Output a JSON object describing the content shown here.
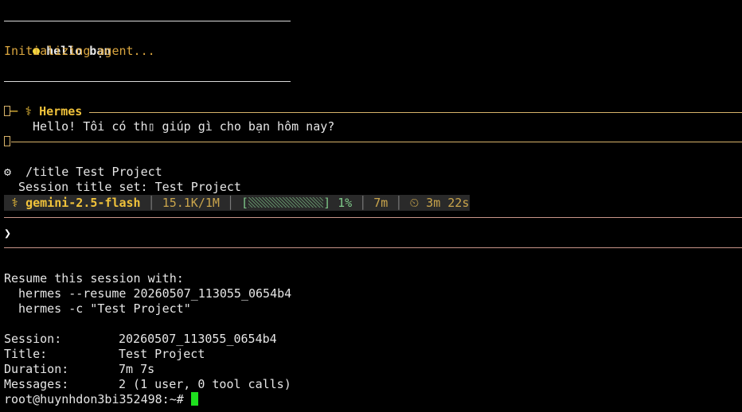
{
  "colors": {
    "background": "#000000",
    "text": "#e6e6e6",
    "accent_gold": "#f0c23b",
    "accent_orange": "#d9a53f",
    "status_green": "#7fc98a",
    "cursor": "#1ee01e"
  },
  "user_message": {
    "bullet_icon": "yellow-dot",
    "text": "hello bạn"
  },
  "status_line": "Initializing agent...",
  "agent_panel": {
    "box_icon": "▯─",
    "agent_icon": "⚕",
    "agent_name": "Hermes",
    "message": "Hello! Tôi có th▯ giúp gì cho bạn hôm nay?",
    "footer_icon": "▯"
  },
  "command": {
    "icon": "⚙",
    "text": "/title Test Project",
    "result": "Session title set: Test Project"
  },
  "status_bar": {
    "model_icon": "⚕",
    "model": "gemini-2.5-flash",
    "tokens": "15.1K/1M",
    "context_open": "[",
    "context_close": "]",
    "context_percent": "1%",
    "context_fill": 0.01,
    "session_time": "7m",
    "timer_icon": "⏲",
    "elapsed": "3m 22s"
  },
  "prompt": {
    "caret": "❯"
  },
  "resume": {
    "heading": "Resume this session with:",
    "command_1": "hermes --resume 20260507_113055_0654b4",
    "command_2": "hermes -c \"Test Project\""
  },
  "summary": {
    "session_label": "Session:",
    "session_value": "20260507_113055_0654b4",
    "title_label": "Title:",
    "title_value": "Test Project",
    "duration_label": "Duration:",
    "duration_value": "7m 7s",
    "messages_label": "Messages:",
    "messages_value": "2 (1 user, 0 tool calls)"
  },
  "shell_prompt": "root@huynhdon3bi352498:~#"
}
